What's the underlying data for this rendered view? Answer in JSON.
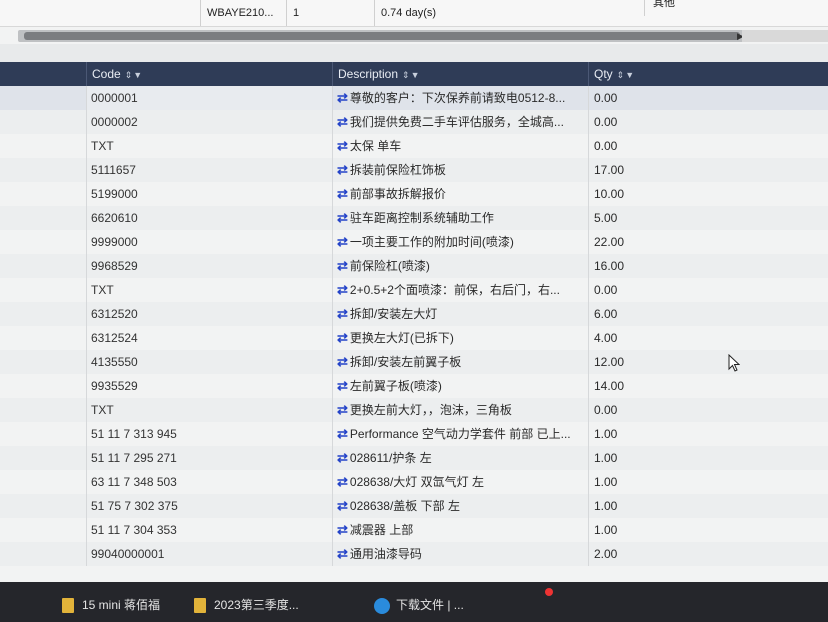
{
  "top_row": {
    "code": "WBAYE210...",
    "count": "1",
    "duration": "0.74 day(s)",
    "right_label": "其他"
  },
  "table": {
    "columns": [
      {
        "label": "Code"
      },
      {
        "label": "Description"
      },
      {
        "label": "Qty"
      }
    ],
    "rows": [
      {
        "code": "0000001",
        "description": "尊敬的客户：下次保养前请致电0512-8...",
        "qty": "0.00"
      },
      {
        "code": "0000002",
        "description": "我们提供免费二手车评估服务，全城高...",
        "qty": "0.00"
      },
      {
        "code": "TXT",
        "description": "太保 单车",
        "qty": "0.00"
      },
      {
        "code": "5111657",
        "description": "拆装前保险杠饰板",
        "qty": "17.00"
      },
      {
        "code": "5199000",
        "description": "前部事故拆解报价",
        "qty": "10.00"
      },
      {
        "code": "6620610",
        "description": "驻车距离控制系统辅助工作",
        "qty": "5.00"
      },
      {
        "code": "9999000",
        "description": "一项主要工作的附加时间(喷漆)",
        "qty": "22.00"
      },
      {
        "code": "9968529",
        "description": "前保险杠(喷漆)",
        "qty": "16.00"
      },
      {
        "code": "TXT",
        "description": "2+0.5+2个面喷漆：前保，右后门，右...",
        "qty": "0.00"
      },
      {
        "code": "6312520",
        "description": "拆卸/安装左大灯",
        "qty": "6.00"
      },
      {
        "code": "6312524",
        "description": "更换左大灯(已拆下)",
        "qty": "4.00"
      },
      {
        "code": "4135550",
        "description": "拆卸/安装左前翼子板",
        "qty": "12.00"
      },
      {
        "code": "9935529",
        "description": "左前翼子板(喷漆)",
        "qty": "14.00"
      },
      {
        "code": "TXT",
        "description": "更换左前大灯，，泡沫，三角板",
        "qty": "0.00"
      },
      {
        "code": "51 11 7 313 945",
        "description": "Performance 空气动力学套件 前部 已上...",
        "qty": "1.00"
      },
      {
        "code": "51 11 7 295 271",
        "description": "028611/护条 左",
        "qty": "1.00"
      },
      {
        "code": "63 11 7 348 503",
        "description": "028638/大灯 双氙气灯 左",
        "qty": "1.00"
      },
      {
        "code": "51 75 7 302 375",
        "description": "028638/盖板 下部 左",
        "qty": "1.00"
      },
      {
        "code": "51 11 7 304 353",
        "description": "减震器 上部",
        "qty": "1.00"
      },
      {
        "code": "99040000001",
        "description": "通用油漆导码",
        "qty": "2.00"
      }
    ]
  },
  "taskbar": {
    "items": [
      {
        "label": "15 mini 蒋佰福"
      },
      {
        "label": "2023第三季度..."
      },
      {
        "label": "下载文件 | ..."
      }
    ]
  },
  "icons": {
    "transfer_icon": "⇄",
    "sort_icon": "⇕",
    "filter_icon": "▼"
  },
  "colors": {
    "header_bg": "#2f3c57",
    "transfer_icon": "#2443c8",
    "folder": "#e2b33a"
  }
}
